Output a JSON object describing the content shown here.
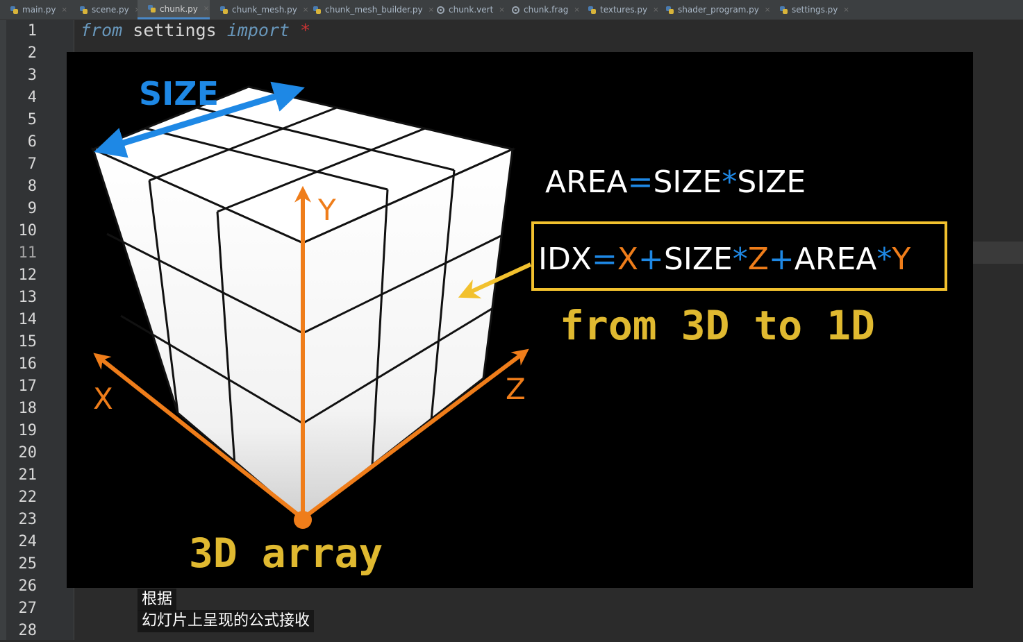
{
  "tabs": [
    {
      "label": "main.py",
      "active": false
    },
    {
      "label": "scene.py",
      "active": false
    },
    {
      "label": "chunk.py",
      "active": true
    },
    {
      "label": "chunk_mesh.py",
      "active": false
    },
    {
      "label": "chunk_mesh_builder.py",
      "active": false
    },
    {
      "label": "chunk.vert",
      "active": false
    },
    {
      "label": "chunk.frag",
      "active": false
    },
    {
      "label": "textures.py",
      "active": false
    },
    {
      "label": "shader_program.py",
      "active": false
    },
    {
      "label": "settings.py",
      "active": false
    }
  ],
  "editor": {
    "line_numbers": [
      "1",
      "2",
      "3",
      "4",
      "5",
      "6",
      "7",
      "8",
      "9",
      "10",
      "11",
      "12",
      "13",
      "14",
      "15",
      "16",
      "17",
      "18",
      "19",
      "20",
      "21",
      "22",
      "23",
      "24",
      "25",
      "26",
      "27",
      "28"
    ],
    "current_line": 11,
    "code_line1": {
      "kw_from": "from",
      "module": "settings",
      "kw_import": "import",
      "star": "*"
    }
  },
  "slide": {
    "size_label": "SIZE",
    "area_formula": {
      "a": "AREA",
      "eq": "=",
      "b": "SIZE",
      "op": "*",
      "c": "SIZE"
    },
    "idx_formula": {
      "idx": "IDX",
      "eq": "=",
      "x": "X",
      "plus1": "+",
      "size": "SIZE",
      "mul1": "*",
      "z": "Z",
      "plus2": "+",
      "area": "AREA",
      "mul2": "*",
      "y": "Y"
    },
    "caption_3d_1d": "from 3D to 1D",
    "caption_array": "3D array",
    "axis_x": "X",
    "axis_y": "Y",
    "axis_z": "Z",
    "colors": {
      "blue": "#1e88e5",
      "orange": "#ef7d1a",
      "yellow": "#f2c12e",
      "white": "#ffffff",
      "caption": "#e0b930"
    }
  },
  "subtitles": {
    "line1": "根据",
    "line2": "幻灯片上呈现的公式接收"
  }
}
